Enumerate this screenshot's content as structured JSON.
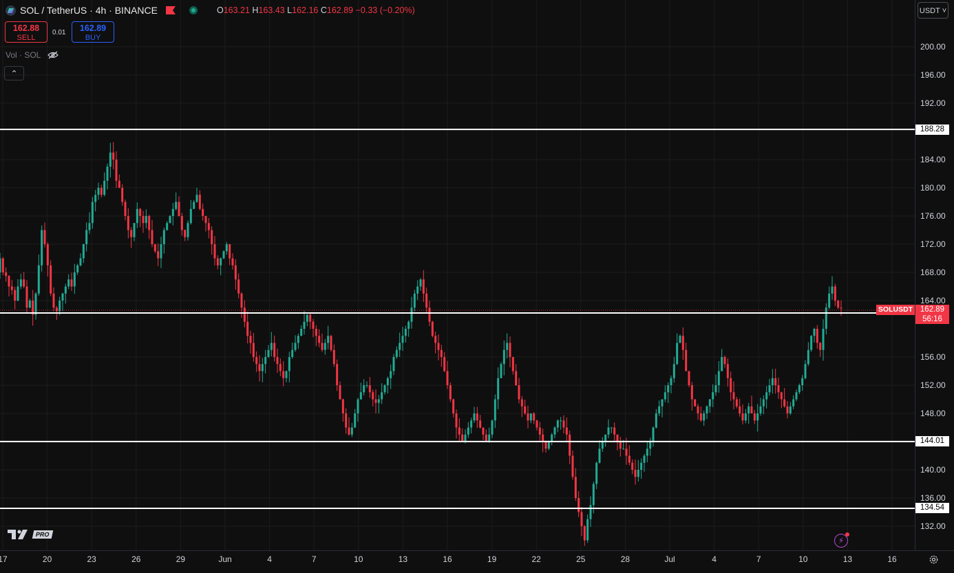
{
  "header": {
    "symbol": "SOL / TetherUS · 4h · BINANCE",
    "open_key": "O",
    "open": "163.21",
    "high_key": "H",
    "high": "163.43",
    "low_key": "L",
    "low": "162.16",
    "close_key": "C",
    "close": "162.89",
    "change": "−0.33 (−0.20%)"
  },
  "trade": {
    "sell_price": "162.88",
    "sell_label": "SELL",
    "spread": "0.01",
    "buy_price": "162.89",
    "buy_label": "BUY"
  },
  "volume_label": "Vol · SOL",
  "currency": "USDT",
  "price_axis": [
    "200.00",
    "196.00",
    "192.00",
    "184.00",
    "180.00",
    "176.00",
    "172.00",
    "168.00",
    "164.00",
    "156.00",
    "152.00",
    "148.00",
    "140.00",
    "136.00",
    "132.00"
  ],
  "time_axis": [
    "17",
    "20",
    "23",
    "26",
    "29",
    "Jun",
    "4",
    "7",
    "10",
    "13",
    "16",
    "19",
    "22",
    "25",
    "28",
    "Jul",
    "4",
    "7",
    "10",
    "13",
    "16"
  ],
  "horizontal_lines": [
    {
      "label": "188.28",
      "value": 188.28
    },
    {
      "label": "162.25",
      "value": 162.25
    },
    {
      "label": "144.01",
      "value": 144.01
    },
    {
      "label": "134.54",
      "value": 134.54
    }
  ],
  "last_price": {
    "symbol": "SOLUSDT",
    "price": "162.89",
    "countdown": "56:16",
    "value": 162.89
  },
  "logo_text": "PRO",
  "colors": {
    "up": "#22ab94",
    "down": "#f23645",
    "background": "#0f0f0f",
    "grid": "#1c1c1c"
  },
  "chart_data": {
    "type": "candlestick",
    "timeframe": "4h",
    "x_range": [
      "May 17",
      "Jul 12"
    ],
    "ylim": [
      130,
      202
    ],
    "grid": true,
    "closes": [
      170,
      168,
      167.5,
      166,
      165.5,
      164,
      166,
      167,
      166,
      163,
      164,
      162,
      165,
      169,
      174,
      172,
      169,
      165,
      163,
      162.5,
      164,
      165,
      166,
      167,
      166,
      168,
      169,
      170,
      172,
      174,
      175,
      178,
      179,
      180,
      179,
      181,
      183,
      185,
      184,
      181,
      180,
      178,
      176,
      174,
      173,
      175,
      177,
      176,
      175,
      176,
      174,
      172,
      171,
      170,
      172,
      174,
      175,
      176,
      177,
      178,
      176,
      174,
      173,
      175,
      177,
      178,
      179,
      177,
      176,
      175,
      174,
      172,
      170,
      169,
      170,
      171,
      172,
      170,
      169,
      167,
      165,
      163,
      161,
      159,
      158,
      156,
      155,
      154,
      155,
      156,
      157,
      158,
      156,
      155,
      154,
      153,
      154,
      156,
      157,
      158,
      159,
      160,
      161,
      162,
      161,
      160,
      159,
      158,
      157,
      158,
      159,
      157,
      155,
      152,
      150,
      148,
      146,
      145,
      146,
      148,
      150,
      151,
      152,
      152,
      151,
      150,
      149.5,
      150,
      151,
      152,
      153,
      154,
      156,
      157,
      158,
      159,
      160,
      161,
      163,
      165,
      166,
      167,
      165,
      163,
      161,
      159,
      158,
      157,
      156,
      154,
      152,
      150,
      148,
      146,
      145,
      144,
      145,
      146,
      147,
      148,
      147,
      146,
      145,
      144,
      145,
      147,
      150,
      153,
      155,
      157,
      158,
      156,
      154,
      152,
      150,
      149,
      148,
      147,
      148,
      147,
      146,
      145,
      144,
      143,
      144,
      145,
      146,
      147,
      147,
      146,
      145,
      142,
      139,
      136,
      134,
      132,
      130,
      133,
      135,
      138,
      141,
      143,
      144,
      145,
      146,
      146,
      145,
      144,
      143,
      143,
      142,
      141,
      140,
      139,
      140,
      141,
      142,
      143,
      144,
      146,
      148,
      149,
      150,
      151,
      152,
      153,
      155,
      158,
      159,
      157,
      154,
      152,
      150,
      149,
      148,
      147,
      148,
      149,
      150,
      151,
      152,
      154,
      156,
      155,
      153,
      151,
      150,
      149,
      148,
      147,
      148,
      149,
      148,
      147,
      148,
      149,
      150,
      151,
      152,
      153,
      152,
      151,
      150,
      149,
      148,
      149,
      150,
      151,
      152,
      153,
      155,
      157,
      159,
      160,
      158,
      157,
      160,
      163,
      165,
      166,
      164,
      163,
      162.89
    ]
  }
}
